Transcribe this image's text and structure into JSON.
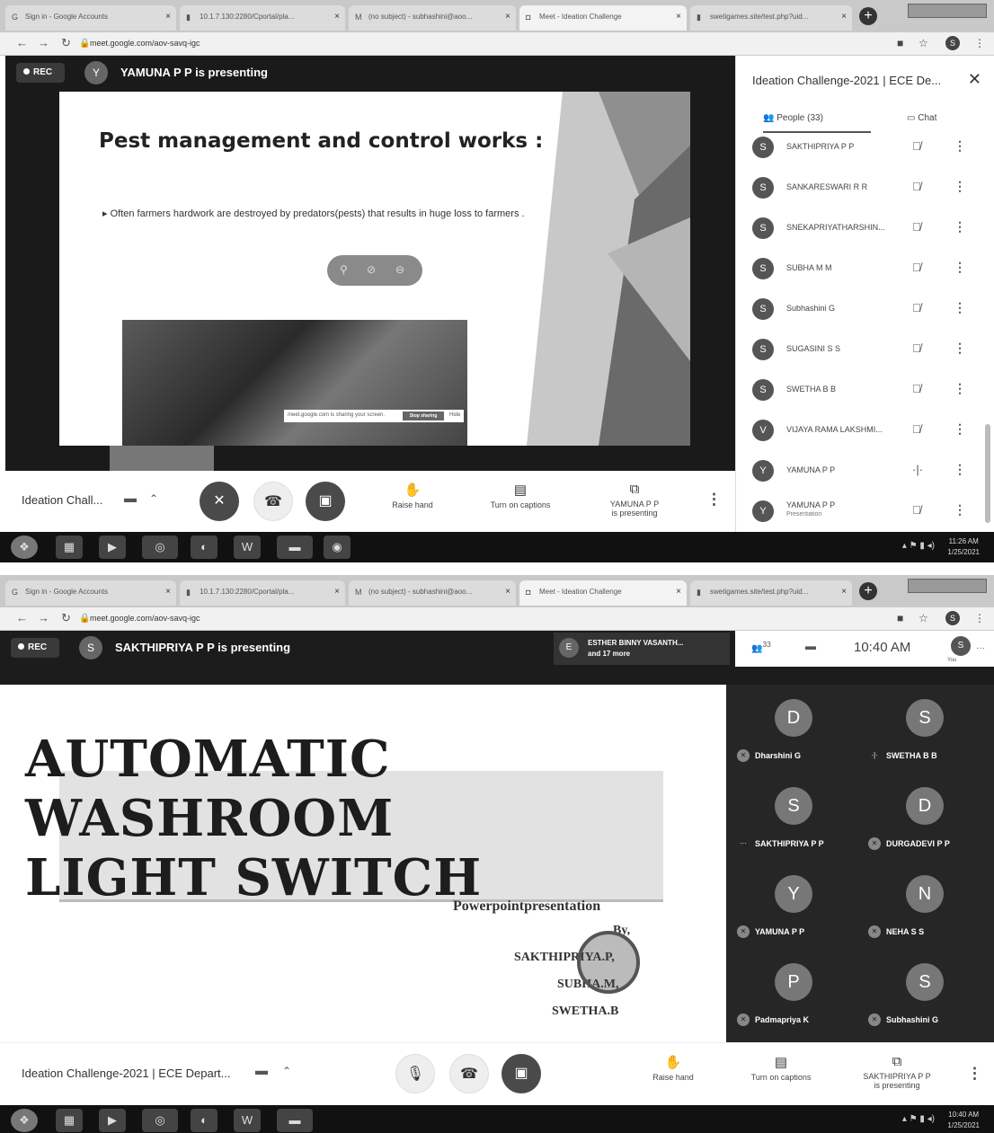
{
  "shot1": {
    "tabs": [
      {
        "label": "Sign in - Google Accounts",
        "active": false
      },
      {
        "label": "10.1.7.130:2280/Cportal/pla...",
        "active": false
      },
      {
        "label": "(no subject) - subhashini@aoo...",
        "active": false
      },
      {
        "label": "Meet - Ideation Challenge",
        "active": true
      },
      {
        "label": "swetigames.site/test.php?uid...",
        "active": false
      }
    ],
    "url": "meet.google.com/aov-savq-igc",
    "rec_label": "REC",
    "presenter_initial": "Y",
    "presenter_text": "YAMUNA P P is presenting",
    "slide": {
      "title": "Pest management and control works :",
      "bullet": "Often farmers hardwork are destroyed by predators(pests) that results in huge loss to farmers .",
      "share_notice": "meet.google.com is sharing your screen.",
      "stop_sharing": "Stop sharing",
      "hide": "Hide"
    },
    "meeting_name": "Ideation Chall...",
    "toolbar": {
      "raise_hand": "Raise hand",
      "captions": "Turn on captions",
      "presenting_name": "YAMUNA P P",
      "presenting_sub": "is presenting"
    },
    "panel": {
      "title": "Ideation Challenge-2021 | ECE De...",
      "people_tab": "People (33)",
      "chat_tab": "Chat",
      "people": [
        {
          "initial": "S",
          "name": "SAKTHIPRIYA P P",
          "sub": ""
        },
        {
          "initial": "S",
          "name": "SANKARESWARI R R",
          "sub": ""
        },
        {
          "initial": "S",
          "name": "SNEKAPRIYATHARSHIN...",
          "sub": ""
        },
        {
          "initial": "S",
          "name": "SUBHA M M",
          "sub": ""
        },
        {
          "initial": "S",
          "name": "Subhashini G",
          "sub": ""
        },
        {
          "initial": "S",
          "name": "SUGASINI S S",
          "sub": ""
        },
        {
          "initial": "S",
          "name": "SWETHA B B",
          "sub": ""
        },
        {
          "initial": "V",
          "name": "VIJAYA RAMA LAKSHMI...",
          "sub": ""
        },
        {
          "initial": "Y",
          "name": "YAMUNA P P",
          "sub": ""
        },
        {
          "initial": "Y",
          "name": "YAMUNA P P",
          "sub": "Presentation"
        }
      ]
    },
    "clock_time": "11:26 AM",
    "clock_date": "1/25/2021"
  },
  "shot2": {
    "tabs": [
      {
        "label": "Sign in - Google Accounts",
        "active": false
      },
      {
        "label": "10.1.7.130:2280/Cportal/pla...",
        "active": false
      },
      {
        "label": "(no subject) - subhashini@aoo...",
        "active": false
      },
      {
        "label": "Meet - Ideation Challenge",
        "active": true
      },
      {
        "label": "swetigames.site/test.php?uid...",
        "active": false
      }
    ],
    "url": "meet.google.com/aov-savq-igc",
    "rec_label": "REC",
    "presenter_initial": "S",
    "presenter_text": "SAKTHIPRIYA P P is presenting",
    "others_initial": "E",
    "others_line1": "ESTHER BINNY VASANTH...",
    "others_line2": "and 17 more",
    "people_count": "33",
    "time": "10:40 AM",
    "you_initial": "S",
    "you_label": "You",
    "slide": {
      "title_line1": "AUTOMATIC WASHROOM",
      "title_line2": "LIGHT SWITCH",
      "subtitle": "Powerpointpresentation",
      "by": "By,",
      "names": [
        "SAKTHIPRIYA.P,",
        "SUBHA.M,",
        "SWETHA.B"
      ]
    },
    "tiles": [
      {
        "initial": "D",
        "name": "Dharshini G"
      },
      {
        "initial": "S",
        "name": "SWETHA B B"
      },
      {
        "initial": "S",
        "name": "SAKTHIPRIYA P P"
      },
      {
        "initial": "D",
        "name": "DURGADEVI P P"
      },
      {
        "initial": "Y",
        "name": "YAMUNA P P"
      },
      {
        "initial": "N",
        "name": "NEHA S S"
      },
      {
        "initial": "P",
        "name": "Padmapriya K"
      },
      {
        "initial": "S",
        "name": "Subhashini G"
      }
    ],
    "meeting_name": "Ideation Challenge-2021 | ECE Depart...",
    "toolbar": {
      "raise_hand": "Raise hand",
      "captions": "Turn on captions",
      "presenting_name": "SAKTHIPRIYA P P",
      "presenting_sub": "is presenting"
    },
    "clock_time": "10:40 AM",
    "clock_date": "1/25/2021"
  }
}
